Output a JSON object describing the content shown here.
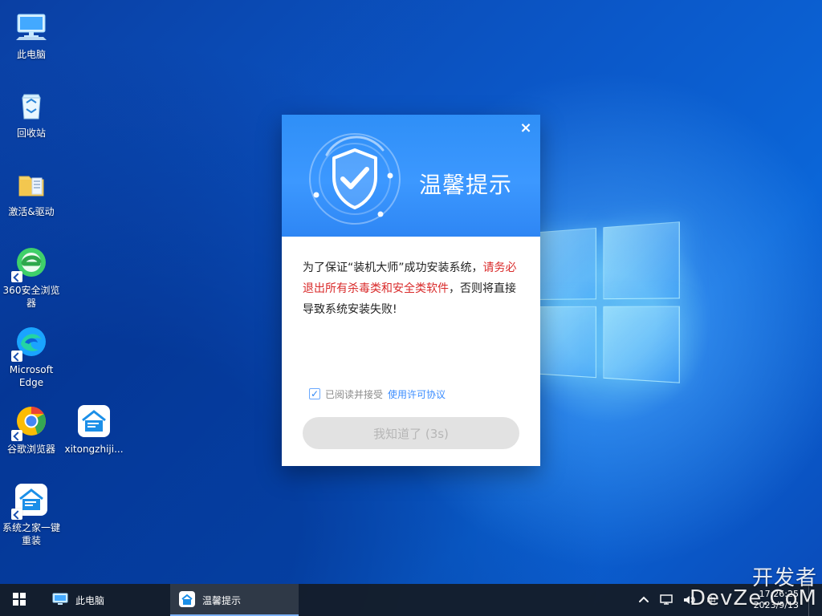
{
  "desktop": {
    "icons": [
      {
        "label": "此电脑"
      },
      {
        "label": "回收站"
      },
      {
        "label": "激活&驱动"
      },
      {
        "label": "360安全浏览器"
      },
      {
        "label": "Microsoft Edge"
      },
      {
        "label": "谷歌浏览器"
      },
      {
        "label": "xitongzhiji..."
      },
      {
        "label": "系统之家一键重装"
      }
    ]
  },
  "dialog": {
    "title": "温馨提示",
    "close_symbol": "×",
    "message_part1": "为了保证“装机大师”成功安装系统，",
    "message_warning": "请务必退出所有杀毒类和安全类软件",
    "message_part2": "，否则将直接导致系统安装失败!",
    "agree_text": "已阅读并接受",
    "license_link": "使用许可协议",
    "confirm_button": "我知道了 (3s)"
  },
  "taskbar": {
    "apps": [
      {
        "label": "此电脑"
      },
      {
        "label": "温馨提示"
      }
    ],
    "ime": "中",
    "clock_time": "17:26:25",
    "clock_date": "2023/9/13"
  },
  "watermark": {
    "line1": "开发者",
    "line2": "DevZe.CoM"
  },
  "colors": {
    "dialog_header": "#2f8ff7",
    "warning_text": "#d92a2a",
    "link": "#3a8cff"
  },
  "icons": {
    "start": "windows-start-icon",
    "pc": "computer-icon",
    "recycle": "recycle-bin-icon",
    "folder": "folder-icon",
    "browser360": "360-browser-icon",
    "edge": "edge-icon",
    "chrome": "chrome-icon",
    "xitong": "system-home-icon",
    "shield": "shield-check-icon"
  }
}
